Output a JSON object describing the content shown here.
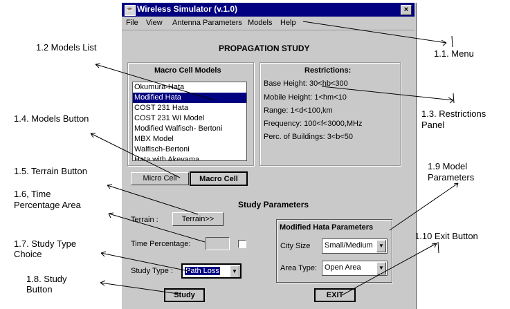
{
  "window": {
    "title": "Wireless Simulator (v.1.0)",
    "close_glyph": "×",
    "icon": "java-cup-icon"
  },
  "menu": [
    "File",
    "View",
    "Antenna Parameters",
    "Models",
    "Help"
  ],
  "page_title": "PROPAGATION STUDY",
  "models_panel": {
    "title": "Macro Cell Models",
    "items": [
      "Okumura-Hata",
      "Modified Hata",
      "COST 231 Hata",
      "COST 231 WI  Model",
      "Modified Walfisch- Bertoni",
      "MBX Model",
      "Walfisch-Bertoni",
      "Hata with Akeyama"
    ],
    "selected": "Modified Hata"
  },
  "restrictions": {
    "title": "Restrictions:",
    "lines": [
      "Base Height: 30<hb<300",
      "Mobile Height: 1<hm<10",
      "Range: 1<d<100,km",
      "Frequency: 100<f<3000,MHz",
      "Perc. of Buildings: 3<b<50"
    ]
  },
  "cell_buttons": {
    "micro": "Micro Cell",
    "macro": "Macro Cell"
  },
  "study_params": {
    "title": "Study Parameters",
    "terrain_label": "Terrain :",
    "terrain_button": "Terrain>>",
    "time_label": "Time Percentage:",
    "study_type_label": "Study Type :",
    "study_type_value": "Path Loss",
    "study_button": "Study"
  },
  "model_params": {
    "title": "Modified Hata Parameters",
    "city_label": "City Size",
    "city_value": "Small/Medium",
    "area_label": "Area Type:",
    "area_value": "Open Area"
  },
  "exit_button": "EXIT",
  "annotations": {
    "menu": "1.1. Menu",
    "models_list": "1.2 Models List",
    "restrictions_1": "1.3. Restrictions",
    "restrictions_2": "Panel",
    "models_button": "1.4. Models Button",
    "terrain_button": "1.5. Terrain Button",
    "time_1": "1.6, Time",
    "time_2": "Percentage Area",
    "study_type_1": "1.7. Study Type",
    "study_type_2": "Choice",
    "study_button_1": "1.8. Study",
    "study_button_2": "Button",
    "model_params_1": "1.9 Model",
    "model_params_2": "Parameters",
    "exit_button": "1.10 Exit Button"
  },
  "colors": {
    "titlebar": "#000080",
    "window_bg": "#c9c9c9",
    "selection": "#000080"
  }
}
